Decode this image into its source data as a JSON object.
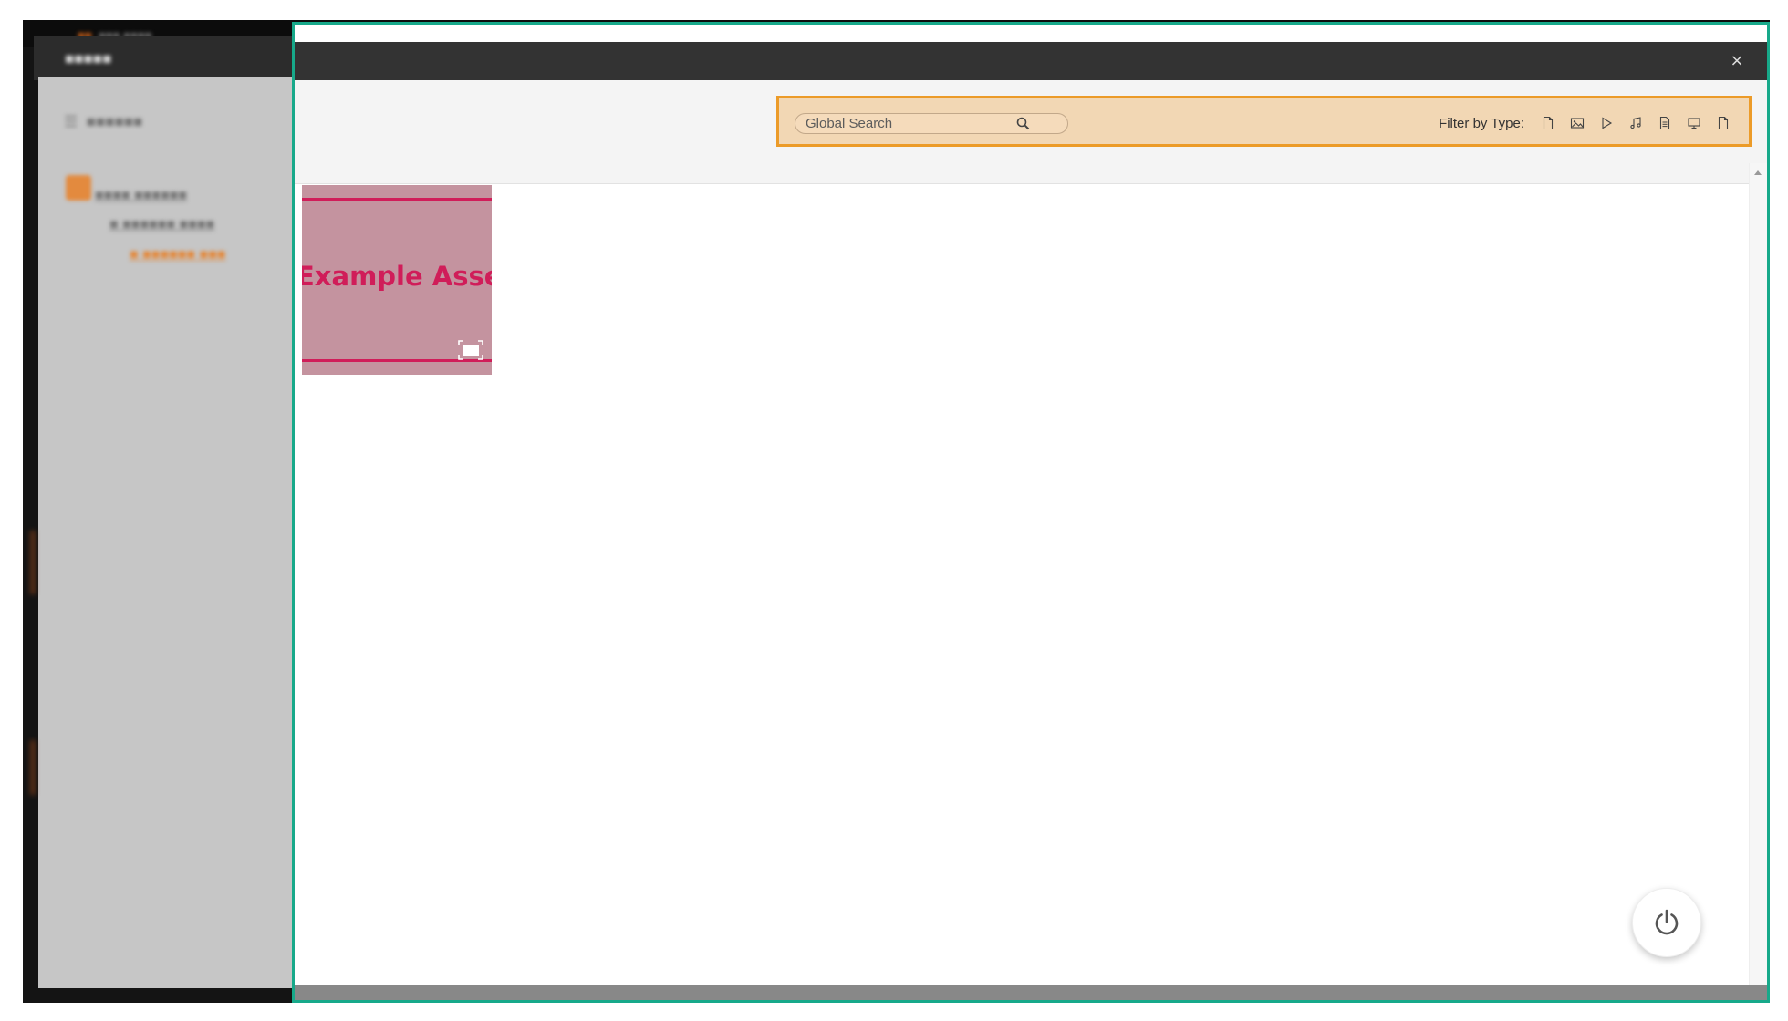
{
  "modal": {
    "close_label": "×"
  },
  "search": {
    "placeholder": "Global Search",
    "value": ""
  },
  "filter": {
    "label": "Filter by Type:",
    "types": [
      {
        "name": "document",
        "icon": "document-icon"
      },
      {
        "name": "image",
        "icon": "image-icon"
      },
      {
        "name": "video",
        "icon": "play-icon"
      },
      {
        "name": "audio",
        "icon": "music-icon"
      },
      {
        "name": "text",
        "icon": "text-file-icon"
      },
      {
        "name": "presentation",
        "icon": "presentation-icon"
      },
      {
        "name": "other",
        "icon": "file-icon"
      }
    ]
  },
  "assets": [
    {
      "title": "Example Asset",
      "type_icon": "image-icon"
    }
  ],
  "colors": {
    "modal_border": "#17a98a",
    "search_bar_bg": "#f2d7b4",
    "search_bar_border": "#ec9b28",
    "asset_accent": "#d01d59",
    "asset_bg": "#c4939f",
    "header_bg": "#333333"
  }
}
